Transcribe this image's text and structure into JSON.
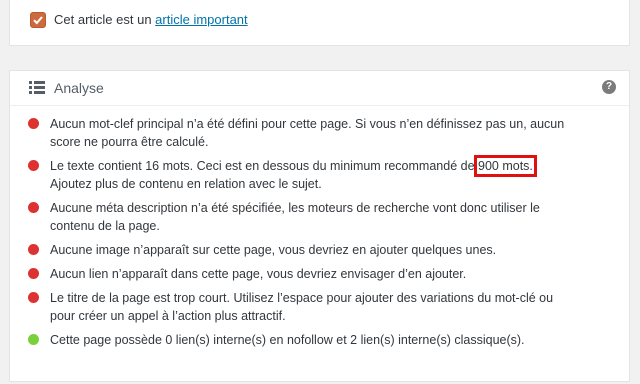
{
  "checkbox_row": {
    "text": "Cet article est un",
    "link": "article important",
    "checked": true,
    "accent_color": "#cc6a3e"
  },
  "analysis": {
    "title": "Analyse",
    "help_symbol": "?",
    "icons": {
      "header": "list-icon",
      "help": "help-icon"
    },
    "status_colors": {
      "bad": "#dc3232",
      "good": "#7ad03a"
    },
    "items": [
      {
        "status": "bad",
        "text": "Aucun mot-clef principal n’a été défini pour cette page. Si vous n’en définissez pas un, aucun score ne pourra être calculé."
      },
      {
        "status": "bad",
        "text_before": "Le texte contient 16 mots. Ceci est en dessous du minimum recommandé de",
        "highlight": "900 mots.",
        "text_after": "Ajoutez plus de contenu en relation avec le sujet."
      },
      {
        "status": "bad",
        "text": "Aucune méta description n’a été spécifiée, les moteurs de recherche vont donc utiliser le contenu de la page."
      },
      {
        "status": "bad",
        "text": "Aucune image n’apparaît sur cette page, vous devriez en ajouter quelques unes."
      },
      {
        "status": "bad",
        "text": "Aucun lien n’apparaît dans cette page, vous devriez envisager d’en ajouter."
      },
      {
        "status": "bad",
        "text": "Le titre de la page est trop court. Utilisez l’espace pour ajouter des variations du mot-clé ou pour créer un appel à l’action plus attractif."
      },
      {
        "status": "good",
        "text": "Cette page possède 0 lien(s) interne(s) en nofollow et 2 lien(s) interne(s) classique(s)."
      }
    ]
  }
}
